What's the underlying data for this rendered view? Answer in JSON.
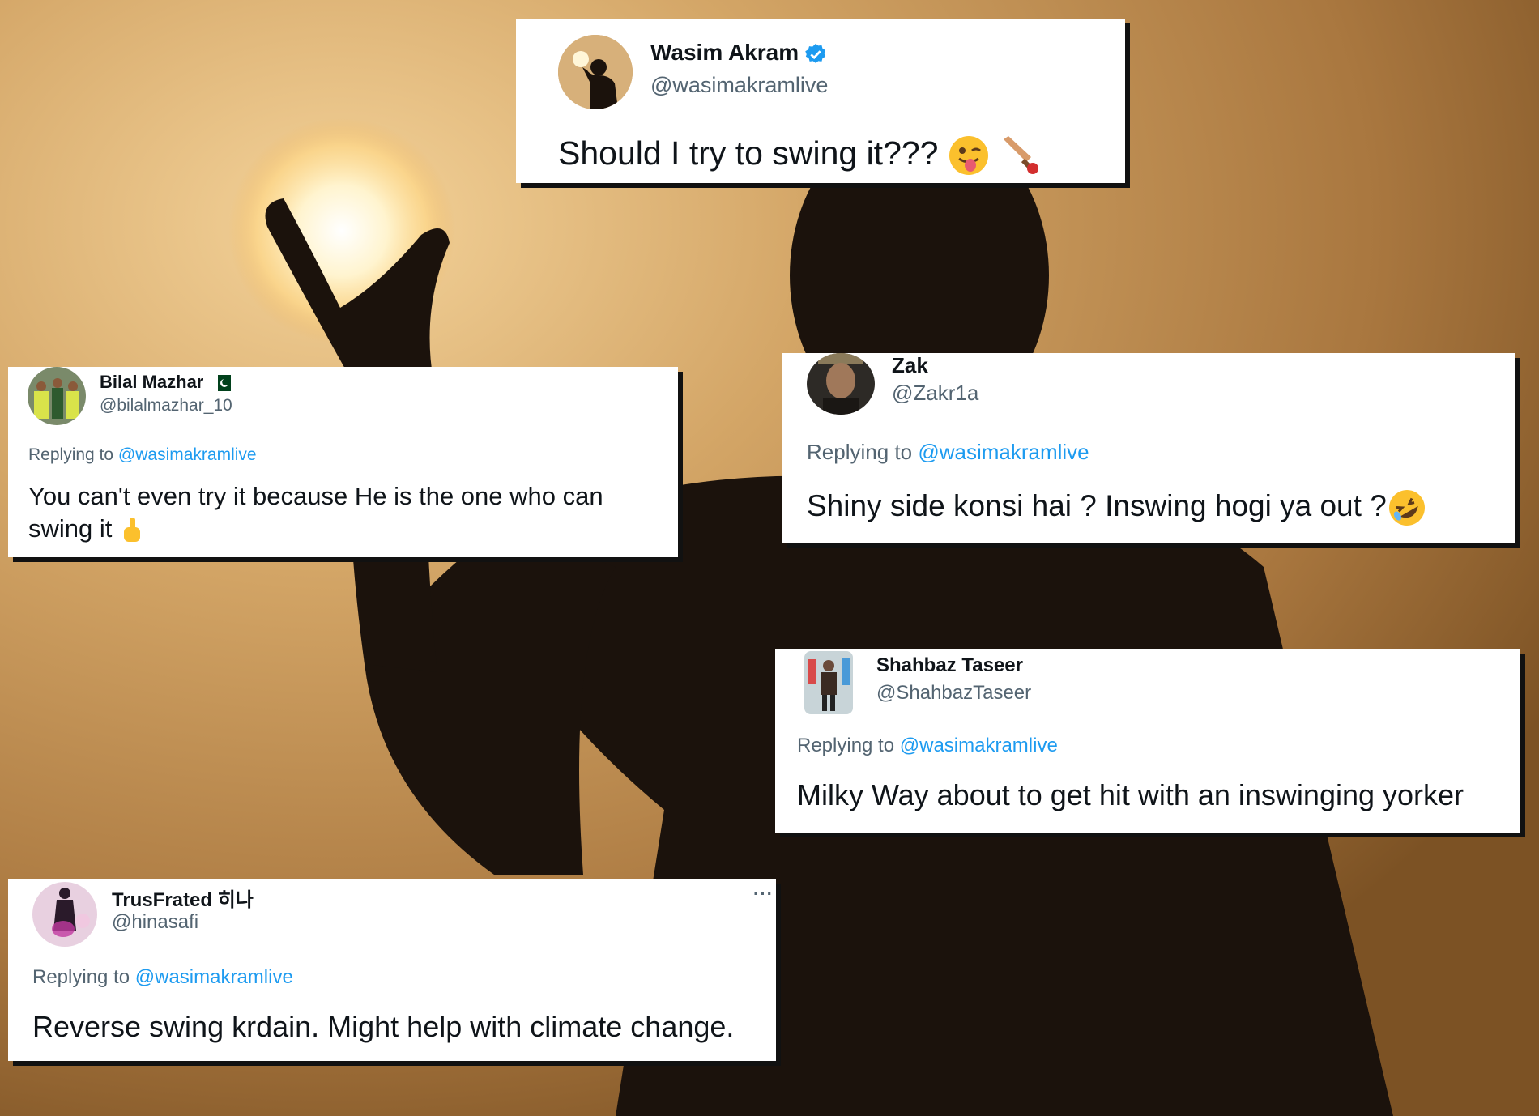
{
  "colors": {
    "accent_link": "#1d9bf0",
    "verified_badge": "#1d9bf0",
    "background_sky": "#b88a52",
    "silhouette": "#1b120c"
  },
  "background": {
    "icon": "silhouette-holding-sun"
  },
  "tweets": [
    {
      "name": "Wasim Akram",
      "handle": "@wasimakramlive",
      "verified": true,
      "text": "Should I try to swing it???",
      "emojis": [
        "winking-tongue-face-emoji",
        "cricket-bat-emoji"
      ]
    },
    {
      "name": "Bilal Mazhar",
      "handle": "@bilalmazhar_10",
      "flag": "pakistan-flag-icon",
      "replying_label": "Replying to",
      "replying_to": "@wasimakramlive",
      "text": "You can't even try it because He is the one who can swing it",
      "emojis": [
        "index-pointing-up-emoji"
      ]
    },
    {
      "name": "Zak",
      "handle": "@Zakr1a",
      "replying_label": "Replying to",
      "replying_to": "@wasimakramlive",
      "text": "Shiny side konsi hai ? Inswing hogi ya out ?",
      "emojis": [
        "rolling-on-floor-laughing-emoji"
      ]
    },
    {
      "name": "Shahbaz Taseer",
      "handle": "@ShahbazTaseer",
      "replying_label": "Replying to",
      "replying_to": "@wasimakramlive",
      "text": "Milky Way about to get hit with an inswinging yorker"
    },
    {
      "name": "TrusFrated 히나",
      "handle": "@hinasafi",
      "more_label": "···",
      "replying_label": "Replying to",
      "replying_to": "@wasimakramlive",
      "text": "Reverse swing krdain. Might help with climate change."
    }
  ]
}
